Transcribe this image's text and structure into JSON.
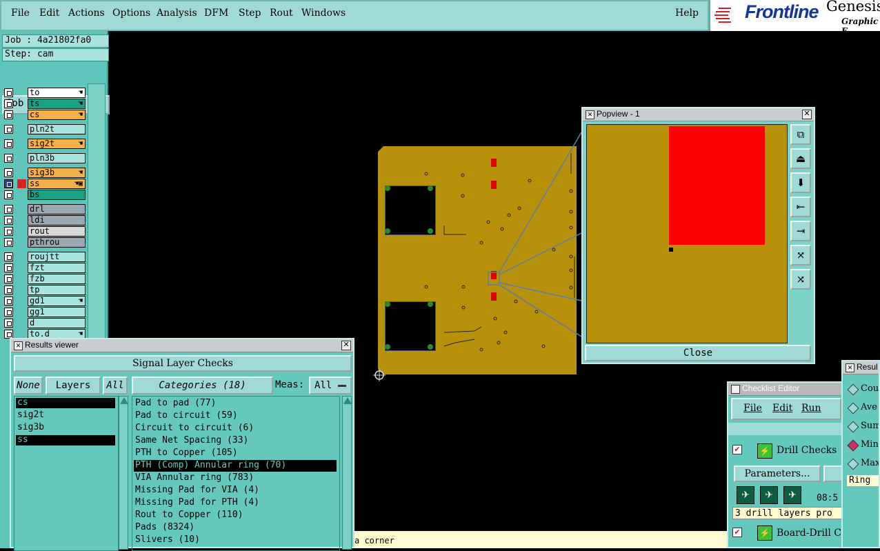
{
  "menubar": {
    "items": [
      {
        "label": "File"
      },
      {
        "label": "Edit"
      },
      {
        "label": "Actions"
      },
      {
        "label": "Options"
      },
      {
        "label": "Analysis"
      },
      {
        "label": "DFM"
      },
      {
        "label": "Step"
      },
      {
        "label": "Rout"
      },
      {
        "label": "Windows"
      }
    ],
    "help": "Help"
  },
  "logo": {
    "brand": "Frontline",
    "product": "Genesis",
    "subtitle": "Graphic E"
  },
  "left_panel": {
    "job": "Job : 4a21802fa0",
    "step": "Step: cam",
    "job_matrix_button": "Job Matrix ...",
    "layers": [
      {
        "name": "to",
        "color": "#ffffff",
        "mark": "☚"
      },
      {
        "name": "ts",
        "color": "#1aa085",
        "mark": "☚"
      },
      {
        "name": "cs",
        "color": "#f5b04a",
        "mark": "☚"
      },
      {
        "name": "pln2t",
        "color": "#a8e3dd",
        "mark": ""
      },
      {
        "name": "sig2t",
        "color": "#f5b04a",
        "mark": "☚"
      },
      {
        "name": "pln3b",
        "color": "#a8e3dd",
        "mark": ""
      },
      {
        "name": "sig3b",
        "color": "#f5b04a",
        "mark": "☚"
      },
      {
        "name": "ss",
        "color": "#f5b04a",
        "mark": "☚▣"
      },
      {
        "name": "bs",
        "color": "#1aa085",
        "mark": ""
      },
      {
        "name": "drl",
        "color": "#9aa8b4",
        "mark": ""
      },
      {
        "name": "ldi",
        "color": "#9aa8b4",
        "mark": ""
      },
      {
        "name": "rout",
        "color": "#d8d8d8",
        "mark": ""
      },
      {
        "name": "pthrou",
        "color": "#9aa8b4",
        "mark": ""
      },
      {
        "name": "roujtt",
        "color": "#a8e3dd",
        "mark": ""
      },
      {
        "name": "fzt",
        "color": "#a8e3dd",
        "mark": ""
      },
      {
        "name": "fzb",
        "color": "#a8e3dd",
        "mark": ""
      },
      {
        "name": "tp",
        "color": "#a8e3dd",
        "mark": ""
      },
      {
        "name": "gd1",
        "color": "#a8e3dd",
        "mark": "☚"
      },
      {
        "name": "gg1",
        "color": "#a8e3dd",
        "mark": ""
      },
      {
        "name": "d",
        "color": "#a8e3dd",
        "mark": ""
      },
      {
        "name": "to.d",
        "color": "#a8e3dd",
        "mark": "☚"
      }
    ]
  },
  "popview": {
    "title": "Popview - 1",
    "close_button": "Close",
    "tools": [
      "popview-fit-icon",
      "pan-up-icon",
      "pan-down-icon",
      "pan-left-icon",
      "pan-right-icon",
      "zoom-in-icon",
      "zoom-out-icon"
    ]
  },
  "results_viewer": {
    "title": "Results viewer",
    "heading": "Signal Layer Checks",
    "none_button": "None",
    "layers_button": "Layers",
    "all_button": "All",
    "categories_button": "Categories (18)",
    "meas_label": "Meas:",
    "meas_value": "All",
    "layers": [
      {
        "name": "cs",
        "selected": true
      },
      {
        "name": "sig2t",
        "selected": false
      },
      {
        "name": "sig3b",
        "selected": false
      },
      {
        "name": "ss",
        "selected": true
      }
    ],
    "categories": [
      {
        "label": "Pad to pad (77)",
        "selected": false
      },
      {
        "label": "Pad to circuit (59)",
        "selected": false
      },
      {
        "label": "Circuit to circuit (6)",
        "selected": false
      },
      {
        "label": "Same Net Spacing (33)",
        "selected": false
      },
      {
        "label": "PTH to Copper (105)",
        "selected": false
      },
      {
        "label": "PTH (Comp) Annular ring (70)",
        "selected": true
      },
      {
        "label": "VIA Annular ring (783)",
        "selected": false
      },
      {
        "label": "Missing Pad for VIA (4)",
        "selected": false
      },
      {
        "label": "Missing Pad for PTH (4)",
        "selected": false
      },
      {
        "label": "Rout to Copper (110)",
        "selected": false
      },
      {
        "label": "Pads (8324)",
        "selected": false
      },
      {
        "label": "Slivers (10)",
        "selected": false
      }
    ]
  },
  "status_text": "a corner",
  "checklist_editor": {
    "title": "Checklist Editor",
    "menu": [
      "File",
      "Edit",
      "Run"
    ],
    "items": [
      {
        "label": "Drill Checks"
      },
      {
        "label": "Board-Drill Ch"
      }
    ],
    "params_button": "Parameters...",
    "time": "08:5",
    "info": "3 drill layers pro"
  },
  "results2": {
    "title": "Resul",
    "options": [
      {
        "label": "Cou",
        "on": false
      },
      {
        "label": "Ave",
        "on": false
      },
      {
        "label": "Sum",
        "on": false
      },
      {
        "label": "Min",
        "on": true
      },
      {
        "label": "Max",
        "on": false
      }
    ],
    "field": "Ring"
  }
}
